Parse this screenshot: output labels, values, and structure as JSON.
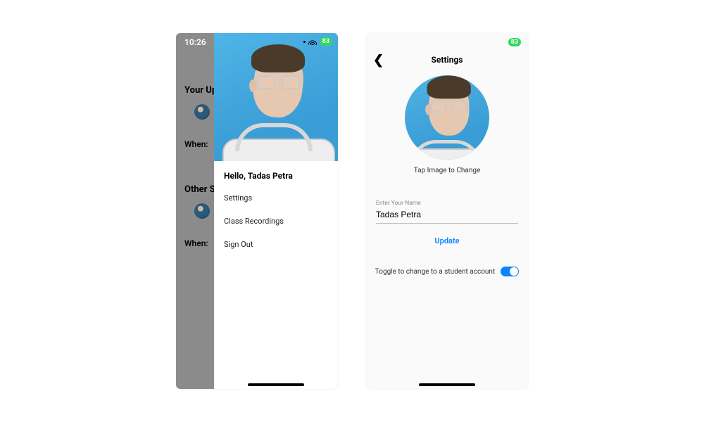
{
  "left": {
    "status_time": "10:26",
    "battery_badge": "83",
    "bg": {
      "section1": "Your Up",
      "when1": "When:",
      "section2": "Other S",
      "when2": "When:"
    },
    "drawer": {
      "greeting": "Hello, Tadas Petra",
      "items": [
        "Settings",
        "Class Recordings",
        "Sign Out"
      ]
    }
  },
  "right": {
    "battery_badge": "83",
    "title": "Settings",
    "tap_hint": "Tap Image to Change",
    "name_label": "Enter Your Name",
    "name_value": "Tadas Petra",
    "update_label": "Update",
    "toggle_label": "Toggle to change to a student account",
    "toggle_on": true
  }
}
